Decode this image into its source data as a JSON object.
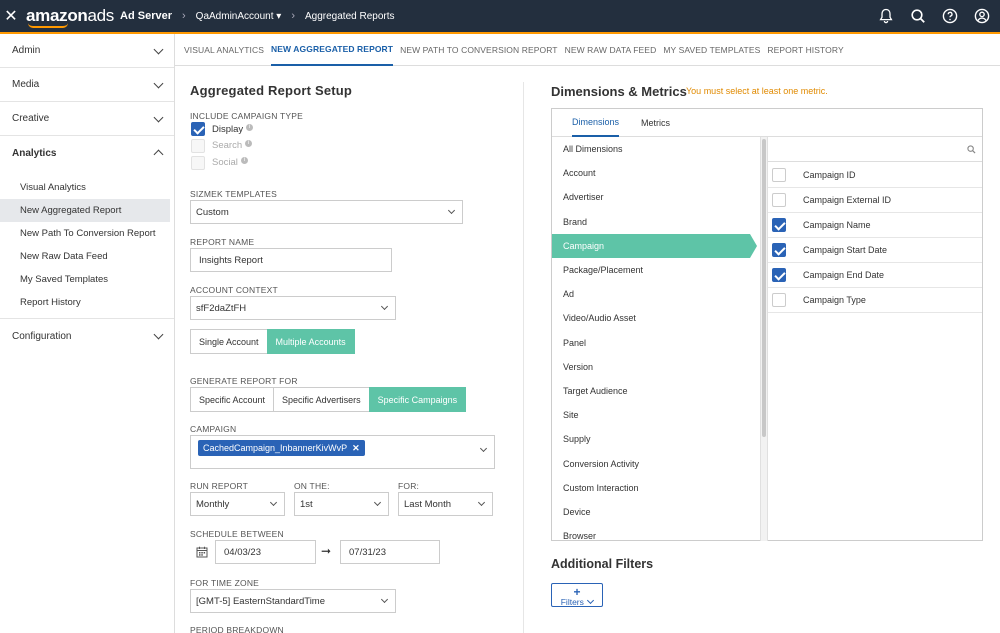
{
  "header": {
    "close_glyph": "✕",
    "logo_a": "amazon",
    "logo_b": "ads",
    "product": "Ad Server",
    "account": "QaAdminAccount",
    "account_caret": "▾",
    "crumb_sep": "›",
    "page": "Aggregated Reports",
    "icons": [
      "bell-icon",
      "search-icon",
      "help-icon",
      "account-icon"
    ]
  },
  "sidebar": {
    "sections": [
      {
        "label": "Admin"
      },
      {
        "label": "Media"
      },
      {
        "label": "Creative"
      },
      {
        "label": "Analytics"
      }
    ],
    "analytics_items": [
      {
        "label": "Visual Analytics"
      },
      {
        "label": "New Aggregated Report"
      },
      {
        "label": "New Path To Conversion Report"
      },
      {
        "label": "New Raw Data Feed"
      },
      {
        "label": "My Saved Templates"
      },
      {
        "label": "Report History"
      }
    ],
    "configuration": "Configuration"
  },
  "tabs": [
    {
      "label": "VISUAL ANALYTICS"
    },
    {
      "label": "NEW AGGREGATED REPORT"
    },
    {
      "label": "NEW PATH TO CONVERSION REPORT"
    },
    {
      "label": "NEW RAW DATA FEED"
    },
    {
      "label": "MY SAVED TEMPLATES"
    },
    {
      "label": "REPORT HISTORY"
    }
  ],
  "setup": {
    "title": "Aggregated Report Setup",
    "include_label": "INCLUDE CAMPAIGN TYPE",
    "info_glyph": "i",
    "types": [
      {
        "label": "Display",
        "checked": true
      },
      {
        "label": "Search",
        "checked": false
      },
      {
        "label": "Social",
        "checked": false
      }
    ],
    "templates_label": "SIZMEK TEMPLATES",
    "templates_value": "Custom",
    "name_label": "REPORT NAME",
    "name_value": "Insights Report",
    "context_label": "ACCOUNT CONTEXT",
    "context_value": "sfF2daZtFH",
    "account_buttons": [
      "Single Account",
      "Multiple Accounts"
    ],
    "generate_label": "GENERATE REPORT FOR",
    "generate_buttons": [
      "Specific Account",
      "Specific Advertisers",
      "Specific Campaigns"
    ],
    "campaign_label": "CAMPAIGN",
    "campaign_chip": "CachedCampaign_InbannerKivWvP",
    "chip_remove": "✕",
    "run_label": "RUN REPORT",
    "run_value": "Monthly",
    "on_label": "ON THE:",
    "on_value": "1st",
    "for_label": "FOR:",
    "for_value": "Last Month",
    "schedule_label": "SCHEDULE BETWEEN",
    "start_date": "04/03/23",
    "end_date": "07/31/23",
    "arrow": "➞",
    "tz_label": "FOR TIME ZONE",
    "tz_value": "[GMT-5] EasternStandardTime",
    "period_label": "PERIOD BREAKDOWN"
  },
  "dims": {
    "title": "Dimensions & Metrics",
    "warning": "You must select at least one metric.",
    "tabs": [
      "Dimensions",
      "Metrics"
    ],
    "categories": [
      "All Dimensions",
      "Account",
      "Advertiser",
      "Brand",
      "Campaign",
      "Package/Placement",
      "Ad",
      "Video/Audio Asset",
      "Panel",
      "Version",
      "Target Audience",
      "Site",
      "Supply",
      "Conversion Activity",
      "Custom Interaction",
      "Device",
      "Browser"
    ],
    "columns": [
      {
        "label": "Campaign ID",
        "checked": false
      },
      {
        "label": "Campaign External ID",
        "checked": false
      },
      {
        "label": "Campaign Name",
        "checked": true
      },
      {
        "label": "Campaign Start Date",
        "checked": true
      },
      {
        "label": "Campaign End Date",
        "checked": true
      },
      {
        "label": "Campaign Type",
        "checked": false
      }
    ]
  },
  "filters": {
    "title": "Additional Filters",
    "plus": "+",
    "button": "Filters"
  }
}
